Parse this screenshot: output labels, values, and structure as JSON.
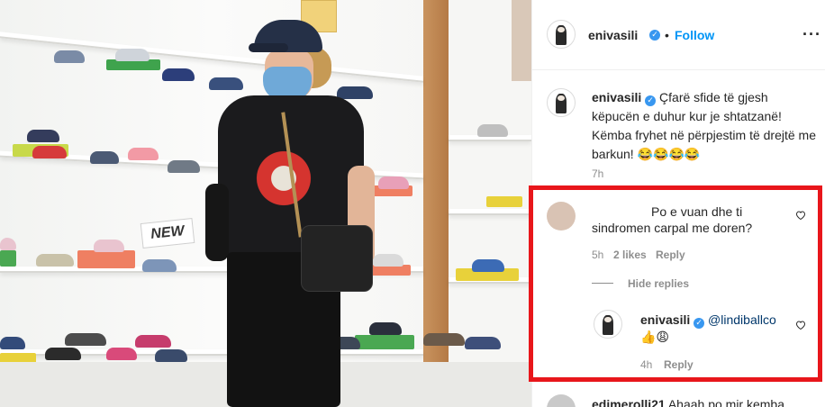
{
  "post": {
    "author": "enivasili",
    "follow_label": "Follow",
    "separator": "•",
    "more_label": "···",
    "verified_glyph": "✓"
  },
  "caption": {
    "author": "enivasili",
    "text": "Çfarë sfide të gjesh këpucën e duhur kur je shtatzanë! Këmba fryhet në përpjestim të drejtë me barkun! 😂😂😂😂",
    "time": "7h"
  },
  "comments": [
    {
      "author": "",
      "text": "Po e vuan dhe ti sindromen carpal me doren?",
      "time": "5h",
      "likes": "2 likes",
      "reply_label": "Reply",
      "hide_replies_label": "Hide replies",
      "replies": [
        {
          "author": "enivasili",
          "mention": "@lindiballco",
          "text": "👍😩",
          "time": "4h",
          "reply_label": "Reply"
        }
      ]
    },
    {
      "author": "edimerolli21",
      "text": "Ahaah po mir kemba",
      "time": "",
      "reply_label": ""
    }
  ],
  "photo": {
    "sign_text": "NEW"
  },
  "colors": {
    "accent": "#0095f6",
    "verified": "#3897f0",
    "highlight": "#e8161b",
    "secondary_text": "#8e8e8e"
  },
  "icons": [
    "verified-badge-icon",
    "more-options-icon",
    "heart-icon",
    "avatar"
  ]
}
